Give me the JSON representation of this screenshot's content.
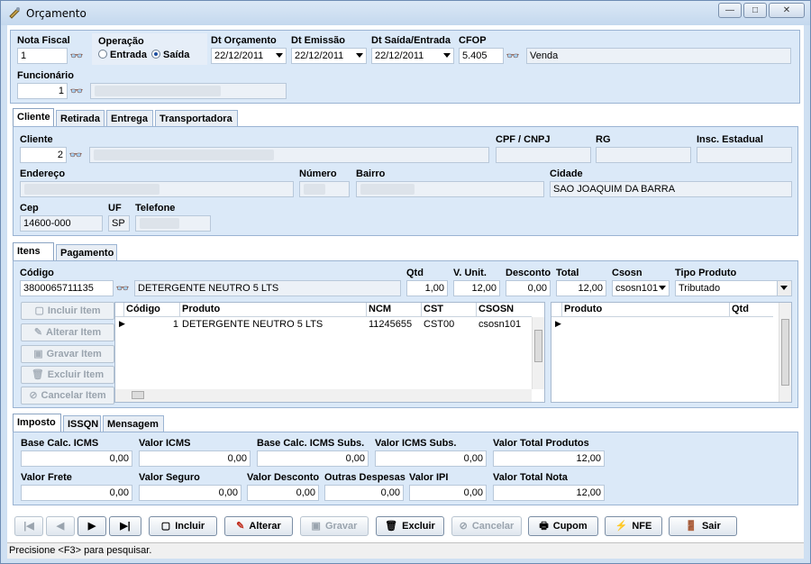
{
  "window": {
    "title": "Orçamento",
    "min_label": "—",
    "max_label": "□",
    "close_label": "✕"
  },
  "header": {
    "nota_fiscal_label": "Nota Fiscal",
    "nota_fiscal_value": "1",
    "operacao_label": "Operação",
    "operacao_options": [
      "Entrada",
      "Saída"
    ],
    "operacao_selected": "Saída",
    "dt_orcamento_label": "Dt Orçamento",
    "dt_orcamento_value": "22/12/2011",
    "dt_emissao_label": "Dt Emissão",
    "dt_emissao_value": "22/12/2011",
    "dt_saida_label": "Dt Saída/Entrada",
    "dt_saida_value": "22/12/2011",
    "cfop_label": "CFOP",
    "cfop_value": "5.405",
    "cfop_desc": "Venda",
    "funcionario_label": "Funcionário",
    "funcionario_value": "1"
  },
  "client_tabs": [
    "Cliente",
    "Retirada",
    "Entrega",
    "Transportadora"
  ],
  "cliente": {
    "cliente_label": "Cliente",
    "cliente_value": "2",
    "cpf_label": "CPF / CNPJ",
    "rg_label": "RG",
    "insc_label": "Insc. Estadual",
    "endereco_label": "Endereço",
    "numero_label": "Número",
    "bairro_label": "Bairro",
    "cidade_label": "Cidade",
    "cidade_value": "SAO JOAQUIM DA BARRA",
    "cep_label": "Cep",
    "cep_value": "14600-000",
    "uf_label": "UF",
    "uf_value": "SP",
    "telefone_label": "Telefone"
  },
  "item_tabs": [
    "Itens",
    "Pagamento"
  ],
  "item_entry": {
    "codigo_label": "Código",
    "codigo_value": "3800065711135",
    "produto_desc": "DETERGENTE NEUTRO 5 LTS",
    "qtd_label": "Qtd",
    "qtd_value": "1,00",
    "vunit_label": "V. Unit.",
    "vunit_value": "12,00",
    "desconto_label": "Desconto",
    "desconto_value": "0,00",
    "total_label": "Total",
    "total_value": "12,00",
    "csosn_label": "Csosn",
    "csosn_value": "csosn101",
    "tipo_label": "Tipo Produto",
    "tipo_value": "Tributado"
  },
  "item_buttons": [
    "Incluir Item",
    "Alterar Item",
    "Gravar Item",
    "Excluir Item",
    "Cancelar Item"
  ],
  "items_grid": {
    "columns": [
      "Código",
      "Produto",
      "NCM",
      "CST",
      "CSOSN"
    ],
    "rows": [
      [
        "1",
        "DETERGENTE NEUTRO 5 LTS",
        "11245655",
        "CST00",
        "csosn101"
      ]
    ]
  },
  "sub_grid": {
    "columns": [
      "Produto",
      "Qtd"
    ]
  },
  "tax_tabs": [
    "Imposto",
    "ISSQN",
    "Mensagem"
  ],
  "imposto": {
    "base_icms_label": "Base Calc. ICMS",
    "base_icms_value": "0,00",
    "valor_icms_label": "Valor ICMS",
    "valor_icms_value": "0,00",
    "base_icms_subs_label": "Base Calc. ICMS Subs.",
    "base_icms_subs_value": "0,00",
    "valor_icms_subs_label": "Valor ICMS Subs.",
    "valor_icms_subs_value": "0,00",
    "valor_total_produtos_label": "Valor Total Produtos",
    "valor_total_produtos_value": "12,00",
    "valor_frete_label": "Valor Frete",
    "valor_frete_value": "0,00",
    "valor_seguro_label": "Valor Seguro",
    "valor_seguro_value": "0,00",
    "valor_desconto_label": "Valor Desconto",
    "valor_desconto_value": "0,00",
    "outras_despesas_label": "Outras Despesas",
    "outras_despesas_value": "0,00",
    "valor_ipi_label": "Valor IPI",
    "valor_ipi_value": "0,00",
    "valor_total_nota_label": "Valor Total Nota",
    "valor_total_nota_value": "12,00"
  },
  "toolbar": {
    "nav_first": "|◀",
    "nav_prev": "◀",
    "nav_next": "▶",
    "nav_last": "▶|",
    "incluir": "Incluir",
    "alterar": "Alterar",
    "gravar": "Gravar",
    "excluir": "Excluir",
    "cancelar": "Cancelar",
    "cupom": "Cupom",
    "nfe": "NFE",
    "sair": "Sair"
  },
  "status_text": "Precisione <F3> para pesquisar.",
  "icons": {
    "binoculars": "binoculars-icon",
    "row_pointer": "row-pointer-icon"
  }
}
